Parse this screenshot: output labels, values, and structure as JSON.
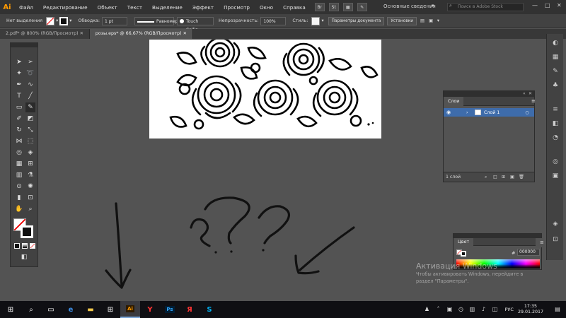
{
  "menu": {
    "logo": "Ai",
    "items": [
      "Файл",
      "Редактирование",
      "Объект",
      "Текст",
      "Выделение",
      "Эффект",
      "Просмотр",
      "Окно",
      "Справка"
    ],
    "bridge_btn": "Br",
    "stock_btn": "St",
    "workspace": "Основные сведения",
    "search_placeholder": "Поиск в Adobe Stock"
  },
  "control": {
    "selection_label": "Нет выделения",
    "stroke_label": "Обводка:",
    "stroke_value": "1 pt",
    "profile_label": "Равномерно",
    "brush_label": "Touch Callig...",
    "opacity_label": "Непрозрачность:",
    "opacity_value": "100%",
    "style_label": "Стиль:",
    "doc_settings_btn": "Параметры документа",
    "prefs_btn": "Установки"
  },
  "tabs": [
    {
      "label": "2.pdf* @ 800% (RGB/Просмотр)"
    },
    {
      "label": "розы.eps* @ 66,67% (RGB/Просмотр)"
    }
  ],
  "layers": {
    "tab": "Слои",
    "layer_name": "Слой 1",
    "count_label": "1 слой"
  },
  "color": {
    "tab": "Цвет",
    "hex_label": "#",
    "hex_value": "000000"
  },
  "watermark": {
    "line1": "Активация Windows",
    "line2": "Чтобы активировать Windows, перейдите в",
    "line3": "раздел \"Параметры\"."
  },
  "taskbar": {
    "lang": "РУС",
    "time": "17:35",
    "date": "29.01.2017"
  },
  "icons": {
    "start": "windows-start-icon",
    "search": "search-icon",
    "taskview": "task-view-icon",
    "edge": "edge-icon",
    "explorer": "file-explorer-icon",
    "store": "store-icon",
    "illustrator": "illustrator-icon",
    "yandex_browser": "yandex-browser-icon",
    "photoshop": "photoshop-icon",
    "yandex": "yandex-icon",
    "skype": "skype-icon"
  },
  "colors": {
    "accent_selected_layer": "#3e6cab",
    "illustrator_orange": "#ff9a00",
    "photoshop_blue": "#31a8ff"
  }
}
